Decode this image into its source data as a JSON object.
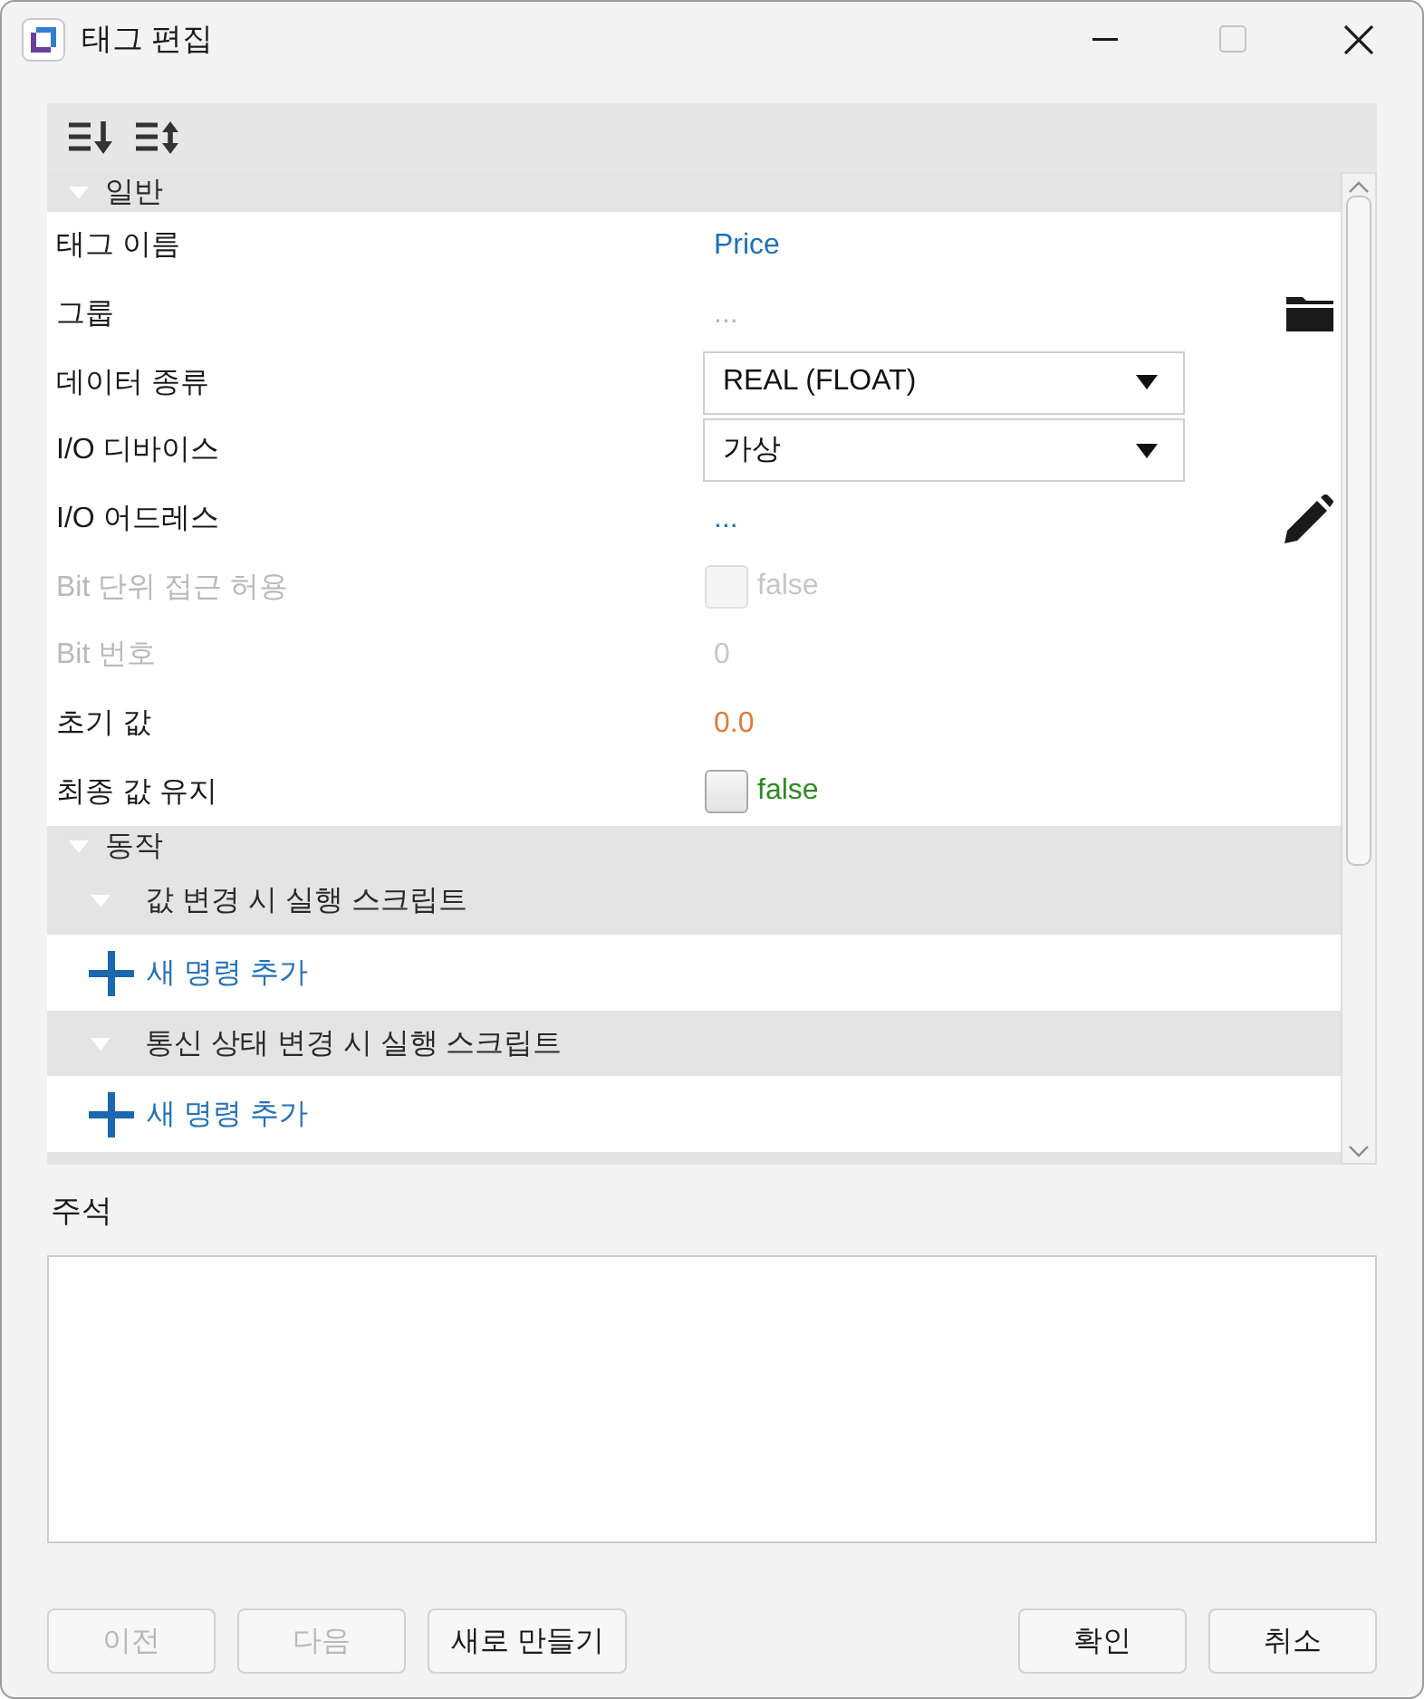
{
  "window": {
    "title": "태그 편집",
    "maximize_disabled": true
  },
  "property_grid": {
    "sections": [
      {
        "kind": "properties",
        "title": "일반",
        "expanded": true,
        "properties": [
          {
            "label": "태그 이름",
            "kind": "text",
            "value": "Price",
            "color": "#1f6fb8",
            "disabled": false
          },
          {
            "label": "그룹",
            "kind": "text",
            "placeholder": "...",
            "disabled": false,
            "browsable": true
          },
          {
            "label": "데이터 종류",
            "kind": "dropdown",
            "value": "REAL (FLOAT)",
            "disabled": false
          },
          {
            "label": "I/O 디바이스",
            "kind": "dropdown",
            "value": "가상",
            "disabled": false
          },
          {
            "label": "I/O 어드레스",
            "kind": "text",
            "value": "...",
            "color": "#1f6fb8",
            "disabled": false,
            "editable": true
          },
          {
            "label": "Bit 단위 접근 허용",
            "kind": "checkbox",
            "checked": false,
            "value": "false",
            "disabled": true
          },
          {
            "label": "Bit 번호",
            "kind": "text",
            "value": "0",
            "disabled": true
          },
          {
            "label": "초기 값",
            "kind": "text",
            "value": "0.0",
            "color": "#e07b3e",
            "disabled": false
          },
          {
            "label": "최종 값 유지",
            "kind": "checkbox",
            "checked": false,
            "value": "false",
            "color": "#2e8a22",
            "disabled": false
          }
        ]
      },
      {
        "kind": "scripts",
        "title": "동작",
        "expanded": true,
        "groups": [
          {
            "title": "값 변경 시 실행 스크립트",
            "expanded": true,
            "add_label": "새 명령 추가"
          },
          {
            "title": "통신 상태 변경 시 실행 스크립트",
            "expanded": true,
            "add_label": "새 명령 추가"
          }
        ]
      }
    ]
  },
  "comment": {
    "label": "주석"
  },
  "buttons_left": [
    {
      "label": "이전",
      "disabled": true
    },
    {
      "label": "다음",
      "disabled": true
    },
    {
      "label": "새로 만들기",
      "disabled": false
    }
  ],
  "buttons_right": [
    {
      "label": "확인",
      "disabled": false
    },
    {
      "label": "취소",
      "disabled": false
    }
  ]
}
